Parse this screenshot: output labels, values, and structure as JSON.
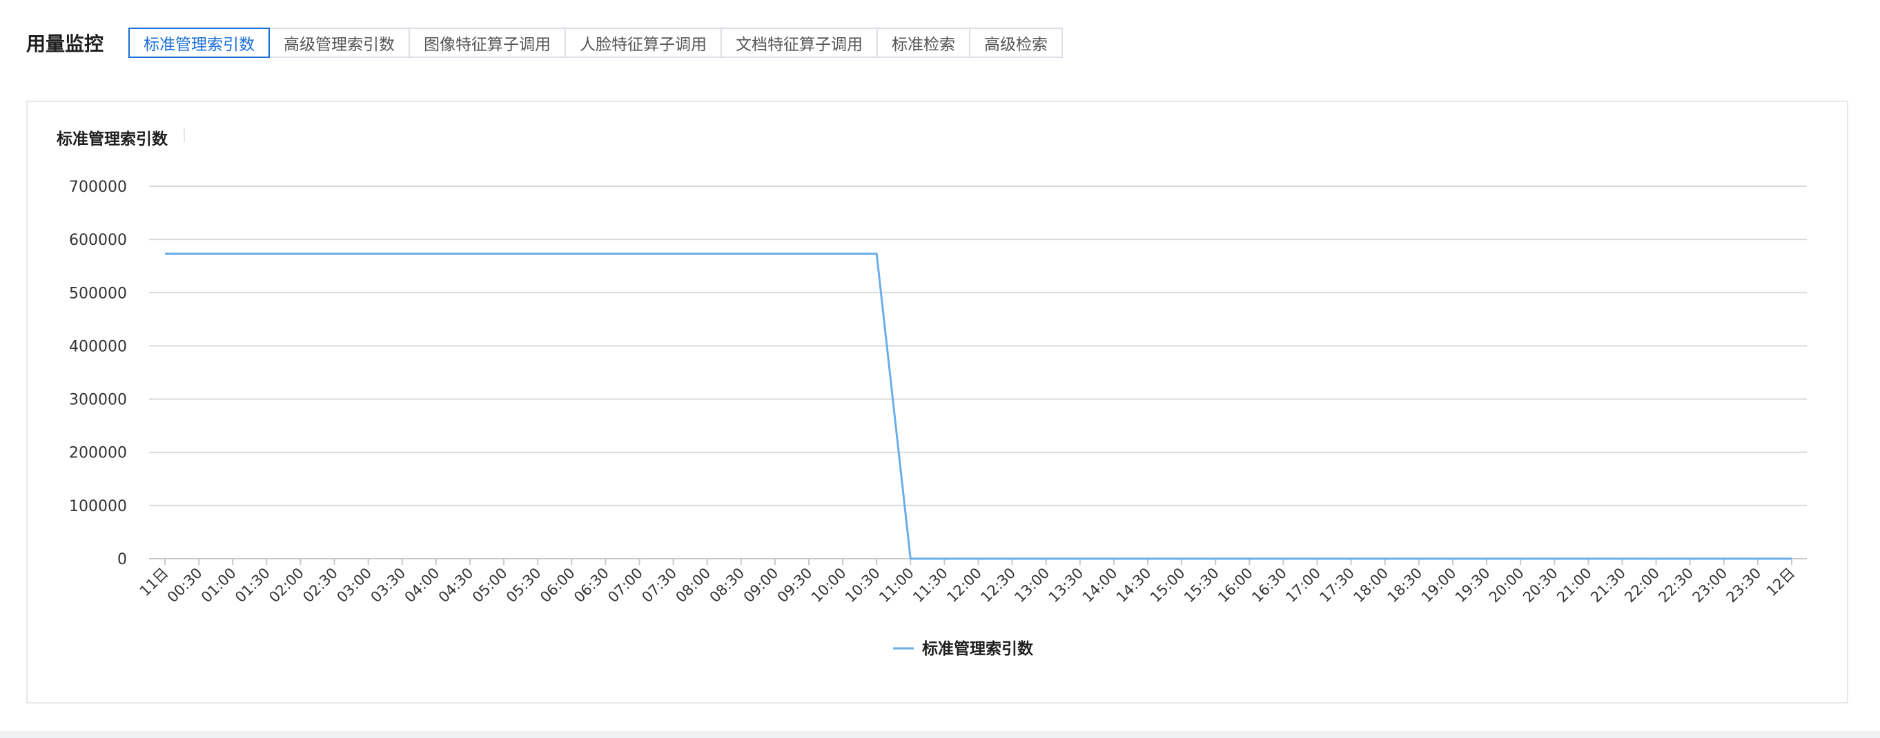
{
  "header": {
    "title": "用量监控",
    "tabs": [
      {
        "label": "标准管理索引数",
        "active": true
      },
      {
        "label": "高级管理索引数",
        "active": false
      },
      {
        "label": "图像特征算子调用",
        "active": false
      },
      {
        "label": "人脸特征算子调用",
        "active": false
      },
      {
        "label": "文档特征算子调用",
        "active": false
      },
      {
        "label": "标准检索",
        "active": false
      },
      {
        "label": "高级检索",
        "active": false
      }
    ]
  },
  "colors": {
    "accent": "#1a6fd8",
    "series_line": "#6aaee9",
    "grid": "#d9d9d9"
  },
  "chart_data": {
    "type": "line",
    "title": "标准管理索引数",
    "xlabel": "",
    "ylabel": "",
    "ylim": [
      0,
      700000
    ],
    "yticks": [
      0,
      100000,
      200000,
      300000,
      400000,
      500000,
      600000,
      700000
    ],
    "grid": true,
    "legend_position": "bottom-center",
    "x": [
      "11日",
      "00:30",
      "01:00",
      "01:30",
      "02:00",
      "02:30",
      "03:00",
      "03:30",
      "04:00",
      "04:30",
      "05:00",
      "05:30",
      "06:00",
      "06:30",
      "07:00",
      "07:30",
      "08:00",
      "08:30",
      "09:00",
      "09:30",
      "10:00",
      "10:30",
      "11:00",
      "11:30",
      "12:00",
      "12:30",
      "13:00",
      "13:30",
      "14:00",
      "14:30",
      "15:00",
      "15:30",
      "16:00",
      "16:30",
      "17:00",
      "17:30",
      "18:00",
      "18:30",
      "19:00",
      "19:30",
      "20:00",
      "20:30",
      "21:00",
      "21:30",
      "22:00",
      "22:30",
      "23:00",
      "23:30",
      "12日"
    ],
    "series": [
      {
        "name": "标准管理索引数",
        "values": [
          573000,
          573000,
          573000,
          573000,
          573000,
          573000,
          573000,
          573000,
          573000,
          573000,
          573000,
          573000,
          573000,
          573000,
          573000,
          573000,
          573000,
          573000,
          573000,
          573000,
          573000,
          573000,
          0,
          0,
          0,
          0,
          0,
          0,
          0,
          0,
          0,
          0,
          0,
          0,
          0,
          0,
          0,
          0,
          0,
          0,
          0,
          0,
          0,
          0,
          0,
          0,
          0,
          0,
          0
        ]
      }
    ]
  }
}
